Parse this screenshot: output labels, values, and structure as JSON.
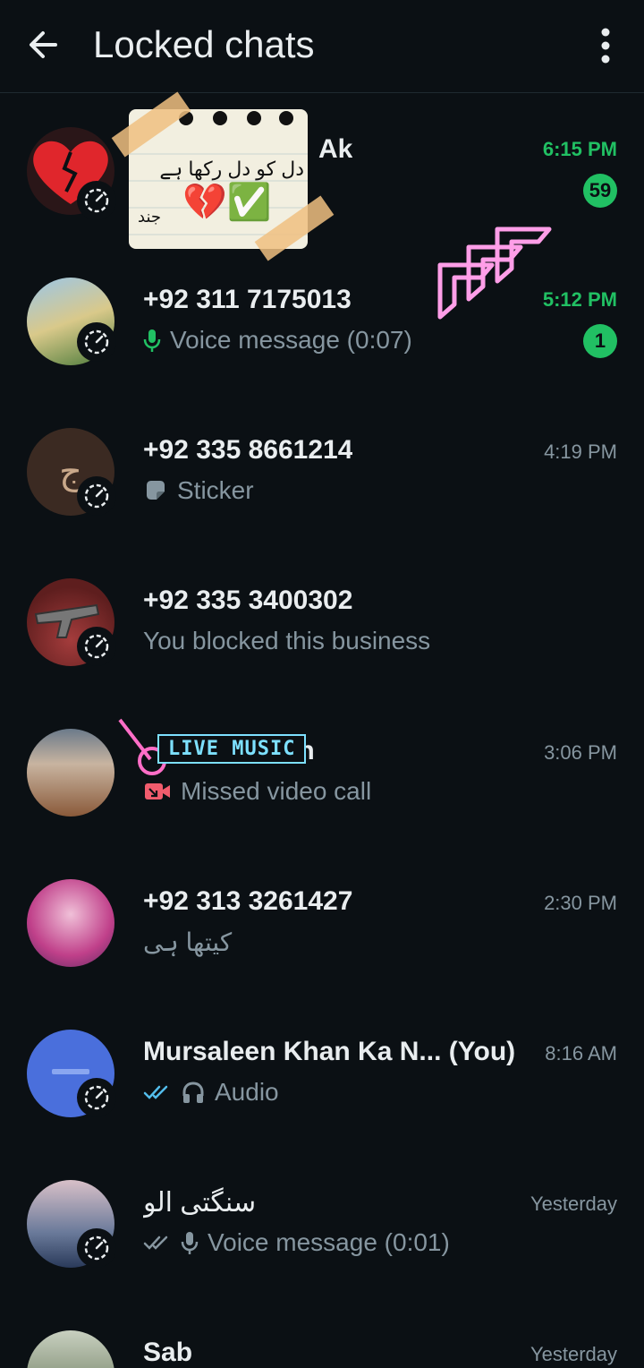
{
  "header": {
    "title": "Locked chats",
    "back_icon": "arrow-left-icon",
    "menu_icon": "more-vertical-icon"
  },
  "chats": [
    {
      "name": "Ak",
      "time": "6:15 PM",
      "time_highlight": true,
      "preview": "",
      "unread": "59",
      "avatar_icon": "broken-heart-icon"
    },
    {
      "name": "+92 311 7175013",
      "time": "5:12 PM",
      "time_highlight": true,
      "preview": "Voice message (0:07)",
      "preview_icon": "mic-icon",
      "unread": "1"
    },
    {
      "name": "+92 335 8661214",
      "time": "4:19 PM",
      "time_highlight": false,
      "preview": "Sticker",
      "preview_icon": "sticker-icon",
      "avatar_letter": "ج"
    },
    {
      "name": "+92 335 3400302",
      "time": "",
      "time_highlight": false,
      "preview": "You blocked this business"
    },
    {
      "name": "...ih",
      "time": "3:06 PM",
      "time_highlight": false,
      "preview": "Missed video call",
      "preview_icon": "missed-video-call-icon"
    },
    {
      "name": "+92 313 3261427",
      "time": "2:30 PM",
      "time_highlight": false,
      "preview": "کیتھا ہی"
    },
    {
      "name": "Mursaleen Khan Ka N... (You)",
      "time": "8:16 AM",
      "time_highlight": false,
      "preview": "Audio",
      "preview_icon": "headphones-icon",
      "ticks": "read"
    },
    {
      "name": "سنگتی الو",
      "time": "Yesterday",
      "time_highlight": false,
      "preview": "Voice message (0:01)",
      "preview_icon": "mic-icon",
      "ticks": "delivered"
    },
    {
      "name": "Sab",
      "time": "Yesterday",
      "time_highlight": false,
      "preview": ""
    }
  ],
  "sticker": {
    "text_line1": "دل کو دل رکھا ہے",
    "text_line2": "جند",
    "emoji": "💔✅"
  },
  "music_sticker": {
    "text": "LIVE MUSIC"
  },
  "colors": {
    "accent": "#21c063",
    "background": "#0b1014",
    "muted": "#8696a0",
    "read_tick": "#53bdeb",
    "missed": "#f15c6d"
  }
}
